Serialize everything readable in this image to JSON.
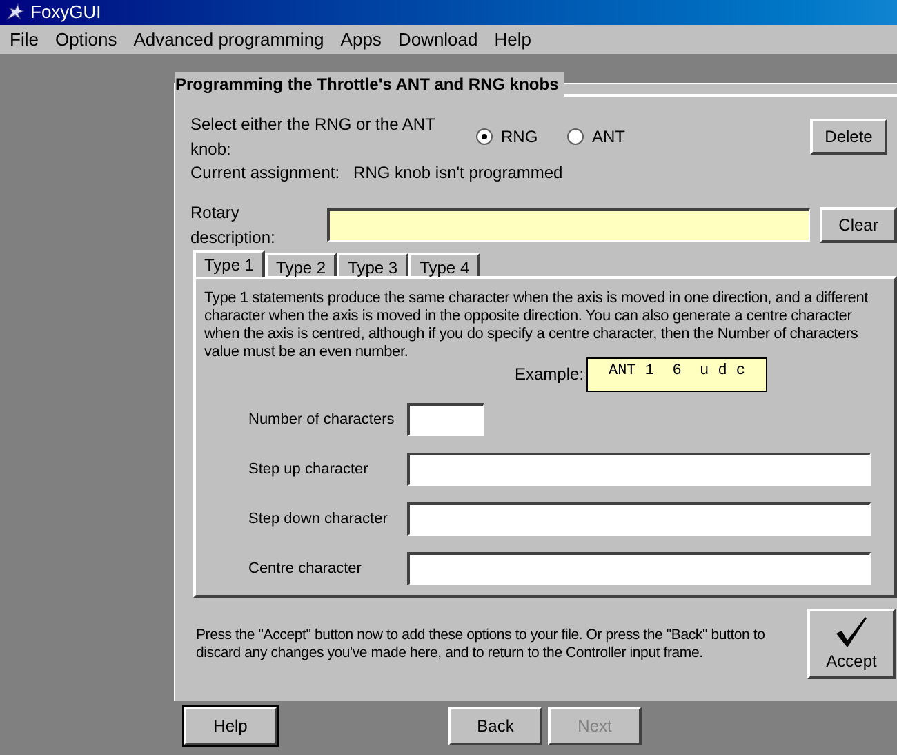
{
  "window": {
    "title": "FoxyGUI"
  },
  "menu": [
    "File",
    "Options",
    "Advanced programming",
    "Apps",
    "Download",
    "Help"
  ],
  "group_title": "Programming the Throttle's ANT and RNG knobs",
  "knob_prompt": "Select either the RNG or the ANT knob:",
  "knobs": [
    {
      "label": "RNG",
      "selected": true
    },
    {
      "label": "ANT",
      "selected": false
    }
  ],
  "delete_button": "Delete",
  "assignment_label": "Current assignment:",
  "assignment_value": "RNG knob isn't programmed",
  "rotary_label": "Rotary description:",
  "clear_button": "Clear",
  "tabs": [
    {
      "label": "Type 1",
      "selected": true
    },
    {
      "label": "Type 2",
      "selected": false
    },
    {
      "label": "Type 3",
      "selected": false
    },
    {
      "label": "Type 4",
      "selected": false
    }
  ],
  "description": "Type 1 statements produce the same character when the axis is moved in one direction, and a different character when the axis is moved in the opposite direction. You can also generate a centre character when the axis is centred, although if you do specify a centre character, then the Number of characters value must be an even number.",
  "example_label": "Example:",
  "example_value": "ANT 1  6  u d c",
  "fields": [
    {
      "label": "Number of characters",
      "kind": "short"
    },
    {
      "label": "Step up character",
      "kind": "long"
    },
    {
      "label": "Step down character",
      "kind": "long"
    },
    {
      "label": "Centre character",
      "kind": "long"
    }
  ],
  "footer_text": "Press the \"Accept\" button now to add these options to your file.  Or press the \"Back\" button to discard any changes you've made here, and to return to the Controller input frame.",
  "accept_button": "Accept",
  "nav_buttons": [
    {
      "label": "Help",
      "disabled": false,
      "focused": true
    },
    {
      "label": "Back",
      "disabled": false,
      "focused": false
    },
    {
      "label": "Next",
      "disabled": true,
      "focused": false
    }
  ]
}
